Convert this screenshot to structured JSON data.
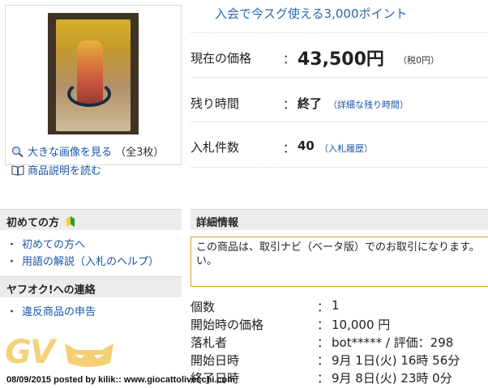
{
  "promo": {
    "text": "入会で今スグ使える3,000ポイント"
  },
  "gallery": {
    "enlarge_label": "大きな画像を見る",
    "count_label": "（全3枚）",
    "description_label": "商品説明を読む"
  },
  "price": {
    "label": "現在の価格",
    "colon": "：",
    "value": "43,500円",
    "tax": "（税0円）"
  },
  "time_left": {
    "label": "残り時間",
    "colon": "：",
    "value": "終了",
    "link": "（詳細な残り時間）"
  },
  "bids": {
    "label": "入札件数",
    "colon": "：",
    "value": "40",
    "link": "（入札履歴）"
  },
  "sidebar": {
    "beginner_head": "初めての方",
    "beginner_links": [
      "初めての方へ",
      "用語の解説（入札のヘルプ）"
    ],
    "contact_head": "ヤフオク!への連絡",
    "contact_links": [
      "違反商品の申告"
    ]
  },
  "detail": {
    "heading": "詳細情報",
    "notice": "この商品は、取引ナビ（ベータ版）でのお取引になります。\nい。",
    "rows": [
      {
        "key": "個数",
        "colon": "：",
        "value": "1"
      },
      {
        "key": "開始時の価格",
        "colon": "：",
        "value": "10,000 円"
      },
      {
        "key": "落札者",
        "colon": "：",
        "value": "bot***** / 評価：298"
      },
      {
        "key": "開始日時",
        "colon": "：",
        "value": "9月 1日(火) 16時 56分"
      },
      {
        "key": "終了日時",
        "colon": "：",
        "value": "9月 8日(火) 23時 0分"
      }
    ]
  },
  "watermark": {
    "logo": "GV",
    "credit": "08/09/2015 posted by kilik:: www.giocattolivecchi.com"
  },
  "colors": {
    "link": "#1a56a6",
    "promo": "#2d65b0",
    "notice_border": "#d59a2a",
    "section_bg": "#ececec"
  }
}
